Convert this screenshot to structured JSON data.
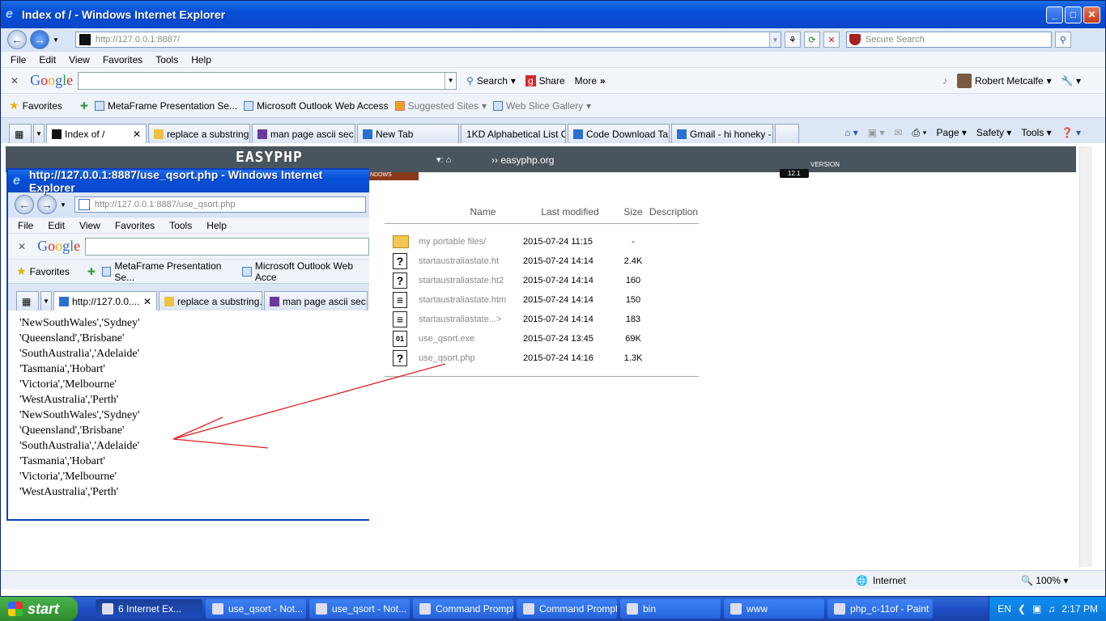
{
  "main_window": {
    "title": "Index of / - Windows Internet Explorer",
    "url_host": "http://127.0.0.1",
    "url_rest": ":8887/",
    "search_placeholder": "Secure Search",
    "menu": [
      "File",
      "Edit",
      "View",
      "Favorites",
      "Tools",
      "Help"
    ],
    "google": {
      "search_label": "Search",
      "share_label": "Share",
      "more_label": "More",
      "user_name": "Robert Metcalfe"
    },
    "favorites_label": "Favorites",
    "favorites": [
      "MetaFrame Presentation Se...",
      "Microsoft Outlook Web Access",
      "Suggested Sites",
      "Web Slice Gallery"
    ],
    "tabs": [
      "Index of /",
      "replace a substring...",
      "man page ascii sec...",
      "New Tab",
      "1KD Alphabetical List O...",
      "Code Download Ta...",
      "Gmail - hi honeky -..."
    ],
    "command_bar": [
      "Page",
      "Safety",
      "Tools"
    ],
    "status": {
      "zone": "Internet",
      "zoom": "100%"
    }
  },
  "easyphp": {
    "logo": "EASYPHP",
    "link": "easyphp.org",
    "version_label": "VERSION",
    "version_badge": "12.1",
    "windows_tab": "NDOWS"
  },
  "listing": {
    "headers": {
      "name": "Name",
      "modified": "Last modified",
      "size": "Size",
      "description": "Description"
    },
    "rows": [
      {
        "name": "my portable files/",
        "date": "2015-07-24 11:15",
        "size": "-",
        "icon": "folder-icon"
      },
      {
        "name": "startaustraliastate.ht",
        "date": "2015-07-24 14:14",
        "size": "2.4K",
        "icon": "unknown-file-icon"
      },
      {
        "name": "startaustraliastate.ht2",
        "date": "2015-07-24 14:14",
        "size": "160",
        "icon": "unknown-file-icon"
      },
      {
        "name": "startaustraliastate.htm",
        "date": "2015-07-24 14:14",
        "size": "150",
        "icon": "text-file-icon"
      },
      {
        "name": "startaustraliastate...>",
        "date": "2015-07-24 14:14",
        "size": "183",
        "icon": "text-file-icon"
      },
      {
        "name": "use_qsort.exe",
        "date": "2015-07-24 13:45",
        "size": "69K",
        "icon": "binary-file-icon"
      },
      {
        "name": "use_qsort.php",
        "date": "2015-07-24 14:16",
        "size": "1.3K",
        "icon": "unknown-file-icon"
      }
    ]
  },
  "popup_window": {
    "title": "http://127.0.0.1:8887/use_qsort.php - Windows Internet Explorer",
    "url_host": "http://127.0.0.1",
    "url_rest": ":8887/use_qsort.php",
    "menu": [
      "File",
      "Edit",
      "View",
      "Favorites",
      "Tools",
      "Help"
    ],
    "favorites_label": "Favorites",
    "favorites": [
      "MetaFrame Presentation Se...",
      "Microsoft Outlook Web Acce"
    ],
    "tabs": [
      "http://127.0.0....",
      "replace a substring...",
      "man page ascii sec..."
    ],
    "output_lines": [
      "'NewSouthWales','Sydney'",
      "'Queensland','Brisbane'",
      "'SouthAustralia','Adelaide'",
      "'Tasmania','Hobart'",
      "'Victoria','Melbourne'",
      "'WestAustralia','Perth'",
      "'NewSouthWales','Sydney'",
      "'Queensland','Brisbane'",
      "'SouthAustralia','Adelaide'",
      "'Tasmania','Hobart'",
      "'Victoria','Melbourne'",
      "'WestAustralia','Perth'"
    ]
  },
  "taskbar": {
    "start_label": "start",
    "buttons": [
      "6 Internet Ex...",
      "use_qsort - Not...",
      "use_qsort - Not...",
      "Command Prompt",
      "Command Prompt",
      "bin",
      "www",
      "php_c-11of - Paint"
    ],
    "language": "EN",
    "clock": "2:17 PM"
  },
  "colors": {
    "titlebar": "#0550d8",
    "annotation_arrow": "#e02020",
    "easyphp_header": "#4a545c"
  }
}
